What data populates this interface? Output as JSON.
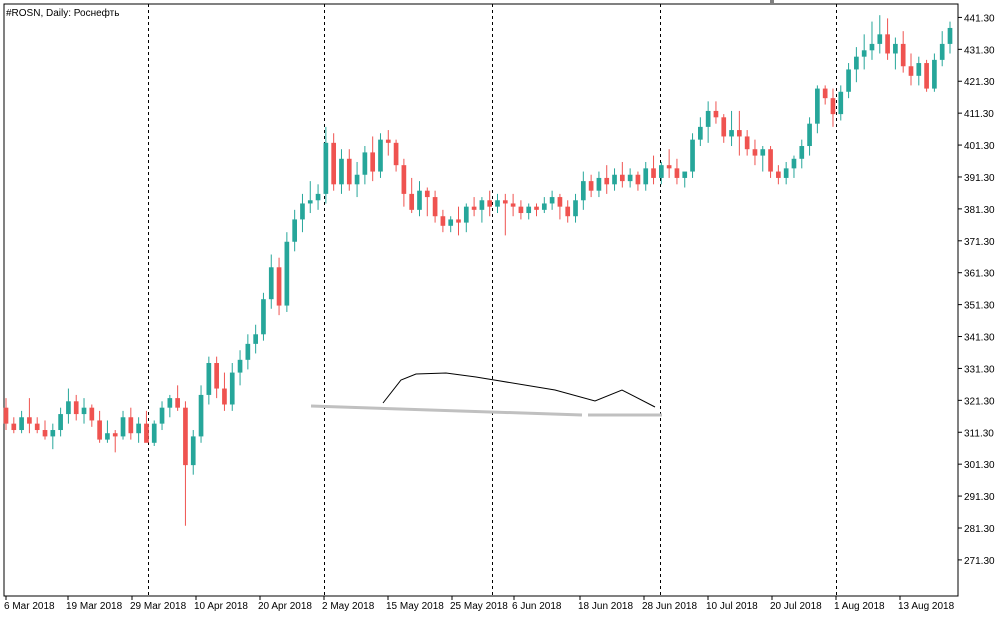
{
  "chart_label": "#ROSN, Daily:  Роснефть",
  "chart_data": {
    "type": "candlestick",
    "symbol": "#ROSN",
    "timeframe": "Daily",
    "ylim": [
      262,
      444
    ],
    "y_ticks": [
      "441.30",
      "431.30",
      "421.30",
      "411.30",
      "401.30",
      "391.30",
      "381.30",
      "371.30",
      "361.30",
      "351.30",
      "341.30",
      "331.30",
      "321.30",
      "311.30",
      "301.30",
      "291.30",
      "281.30",
      "271.30"
    ],
    "x_ticks": [
      "6 Mar 2018",
      "19 Mar 2018",
      "29 Mar 2018",
      "10 Apr 2018",
      "20 Apr 2018",
      "2 May 2018",
      "15 May 2018",
      "25 May 2018",
      "6 Jun 2018",
      "18 Jun 2018",
      "28 Jun 2018",
      "10 Jul 2018",
      "20 Jul 2018",
      "1 Aug 2018",
      "13 Aug 2018"
    ],
    "period_separators": [
      "29 Mar 2018",
      "2 May 2018",
      "1 Jun 2018",
      "2 Jul 2018",
      "1 Aug 2018"
    ],
    "colors": {
      "bull": "#26a69a",
      "bear": "#ef5350",
      "grid": "#000000",
      "trendline": "#c0c0c0",
      "pattern": "#000000"
    },
    "candles": [
      [
        319,
        322,
        312,
        314
      ],
      [
        314,
        316,
        311,
        312
      ],
      [
        312,
        318,
        311,
        316
      ],
      [
        316,
        322,
        311,
        314
      ],
      [
        314,
        316,
        311,
        312
      ],
      [
        312,
        315,
        309,
        310
      ],
      [
        310,
        314,
        306,
        312
      ],
      [
        312,
        319,
        310,
        317
      ],
      [
        317,
        325,
        314,
        321
      ],
      [
        321,
        323,
        315,
        317
      ],
      [
        317,
        322,
        314,
        319
      ],
      [
        319,
        320,
        313,
        315
      ],
      [
        315,
        318,
        308,
        309
      ],
      [
        309,
        315,
        308,
        311
      ],
      [
        311,
        312,
        305,
        310
      ],
      [
        310,
        318,
        309,
        316
      ],
      [
        316,
        319,
        309,
        311
      ],
      [
        311,
        316,
        308,
        314
      ],
      [
        314,
        318,
        309,
        308
      ],
      [
        308,
        315,
        307,
        314
      ],
      [
        314,
        321,
        312,
        319
      ],
      [
        319,
        323,
        316,
        322
      ],
      [
        322,
        326,
        318,
        319
      ],
      [
        319,
        321,
        282,
        301
      ],
      [
        301,
        312,
        298,
        310
      ],
      [
        310,
        326,
        308,
        323
      ],
      [
        323,
        335,
        320,
        333
      ],
      [
        333,
        335,
        322,
        325
      ],
      [
        325,
        330,
        318,
        320
      ],
      [
        320,
        333,
        318,
        330
      ],
      [
        330,
        337,
        326,
        334
      ],
      [
        334,
        342,
        331,
        339
      ],
      [
        339,
        345,
        336,
        342
      ],
      [
        342,
        355,
        340,
        353
      ],
      [
        353,
        367,
        350,
        363
      ],
      [
        363,
        366,
        348,
        351
      ],
      [
        351,
        374,
        349,
        371
      ],
      [
        371,
        381,
        368,
        378
      ],
      [
        378,
        386,
        374,
        383
      ],
      [
        383,
        390,
        380,
        384
      ],
      [
        384,
        389,
        381,
        386
      ],
      [
        386,
        407,
        383,
        402
      ],
      [
        402,
        405,
        387,
        389
      ],
      [
        389,
        400,
        386,
        397
      ],
      [
        397,
        400,
        387,
        389
      ],
      [
        389,
        396,
        385,
        392
      ],
      [
        392,
        401,
        389,
        399
      ],
      [
        399,
        404,
        390,
        393
      ],
      [
        393,
        405,
        391,
        403
      ],
      [
        403,
        406,
        398,
        402
      ],
      [
        402,
        403,
        393,
        395
      ],
      [
        395,
        397,
        382,
        386
      ],
      [
        386,
        391,
        380,
        381
      ],
      [
        381,
        390,
        379,
        387
      ],
      [
        387,
        388,
        379,
        385
      ],
      [
        385,
        387,
        377,
        379
      ],
      [
        379,
        381,
        374,
        376
      ],
      [
        376,
        379,
        374,
        378
      ],
      [
        378,
        382,
        373,
        377
      ],
      [
        377,
        383,
        374,
        382
      ],
      [
        382,
        385,
        379,
        381
      ],
      [
        381,
        385,
        377,
        384
      ],
      [
        384,
        387,
        379,
        382
      ],
      [
        382,
        386,
        380,
        384
      ],
      [
        384,
        386,
        373,
        383
      ],
      [
        383,
        386,
        379,
        382
      ],
      [
        382,
        384,
        378,
        380
      ],
      [
        380,
        383,
        378,
        382
      ],
      [
        382,
        383,
        379,
        381
      ],
      [
        381,
        385,
        380,
        383
      ],
      [
        383,
        387,
        381,
        385
      ],
      [
        385,
        386,
        378,
        382
      ],
      [
        382,
        384,
        377,
        379
      ],
      [
        379,
        386,
        377,
        384
      ],
      [
        384,
        393,
        381,
        390
      ],
      [
        390,
        392,
        385,
        387
      ],
      [
        387,
        393,
        385,
        391
      ],
      [
        391,
        395,
        386,
        389
      ],
      [
        389,
        394,
        387,
        392
      ],
      [
        392,
        396,
        388,
        390
      ],
      [
        390,
        394,
        388,
        392
      ],
      [
        392,
        393,
        387,
        389
      ],
      [
        389,
        396,
        387,
        394
      ],
      [
        394,
        398,
        389,
        391
      ],
      [
        391,
        396,
        389,
        395
      ],
      [
        395,
        400,
        391,
        394
      ],
      [
        394,
        397,
        389,
        391
      ],
      [
        391,
        392,
        388,
        393
      ],
      [
        393,
        405,
        391,
        403
      ],
      [
        403,
        410,
        401,
        407
      ],
      [
        407,
        415,
        402,
        412
      ],
      [
        412,
        415,
        408,
        410
      ],
      [
        410,
        411,
        402,
        404
      ],
      [
        404,
        412,
        401,
        406
      ],
      [
        406,
        412,
        398,
        404
      ],
      [
        404,
        406,
        398,
        400
      ],
      [
        400,
        403,
        395,
        398
      ],
      [
        398,
        401,
        393,
        400
      ],
      [
        400,
        401,
        391,
        393
      ],
      [
        393,
        395,
        389,
        391
      ],
      [
        391,
        396,
        389,
        394
      ],
      [
        394,
        398,
        391,
        397
      ],
      [
        397,
        403,
        394,
        401
      ],
      [
        401,
        410,
        398,
        408
      ],
      [
        408,
        420,
        405,
        419
      ],
      [
        419,
        420,
        414,
        416
      ],
      [
        416,
        419,
        407,
        411
      ],
      [
        411,
        420,
        409,
        418
      ],
      [
        418,
        427,
        416,
        425
      ],
      [
        425,
        432,
        421,
        429
      ],
      [
        429,
        436,
        425,
        431
      ],
      [
        431,
        440,
        428,
        433
      ],
      [
        433,
        442,
        430,
        436
      ],
      [
        436,
        441,
        428,
        430
      ],
      [
        430,
        435,
        425,
        433
      ],
      [
        433,
        437,
        424,
        426
      ],
      [
        426,
        430,
        420,
        423
      ],
      [
        423,
        429,
        420,
        427
      ],
      [
        427,
        428,
        418,
        419
      ],
      [
        419,
        430,
        418,
        428
      ],
      [
        428,
        437,
        426,
        433
      ],
      [
        433,
        440,
        430,
        438
      ]
    ],
    "pattern_line": [
      [
        383,
        403
      ],
      [
        401,
        380
      ],
      [
        416,
        374
      ],
      [
        446,
        373
      ],
      [
        476,
        377
      ],
      [
        482,
        378
      ],
      [
        555,
        390
      ],
      [
        595,
        401
      ],
      [
        622,
        390
      ],
      [
        655,
        407
      ]
    ],
    "resistance_lines": [
      [
        [
          311,
          406
        ],
        [
          582,
          415
        ]
      ],
      [
        [
          588,
          415
        ],
        [
          662,
          415
        ]
      ]
    ]
  }
}
